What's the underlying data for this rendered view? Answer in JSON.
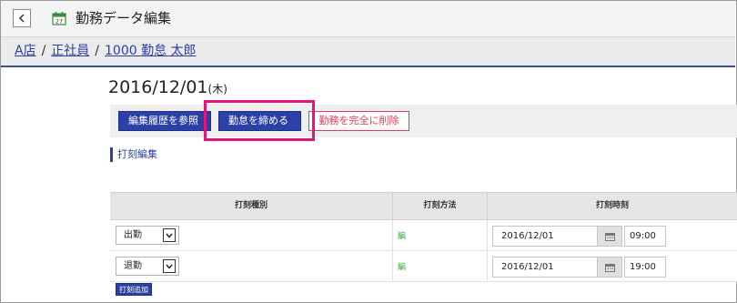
{
  "header": {
    "back_icon": "chevron-left-icon",
    "calendar_icon": "calendar-icon",
    "calendar_day": "27",
    "title": "勤務データ編集"
  },
  "breadcrumb": {
    "store": "A店",
    "employment_type": "正社員",
    "employee": "1000 勤怠 太郎",
    "separator": "/"
  },
  "date": {
    "value": "2016/12/01",
    "day_of_week": "(木)"
  },
  "actions": {
    "history_label": "編集履歴を参照",
    "close_label": "勤怠を締める",
    "delete_label": "勤務を完全に削除"
  },
  "section": {
    "label": "打刻編集"
  },
  "table": {
    "headers": {
      "type": "打刻種別",
      "method": "打刻方法",
      "time": "打刻時刻"
    },
    "rows": [
      {
        "type": "出勤",
        "method": "編",
        "date": "2016/12/01",
        "time": "09:00"
      },
      {
        "type": "退勤",
        "method": "編",
        "date": "2016/12/01",
        "time": "19:00"
      }
    ],
    "add_label": "打刻追加"
  },
  "colors": {
    "primary": "#2c41a8",
    "danger": "#e03c5a",
    "highlight": "#e4157a",
    "method_green": "#2eaa3a"
  }
}
